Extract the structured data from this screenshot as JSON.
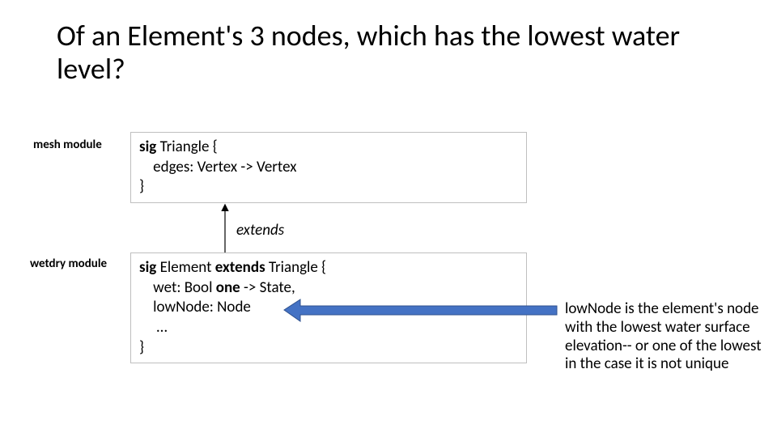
{
  "title": "Of an Element's 3 nodes, which has the lowest water level?",
  "labels": {
    "mesh": "mesh module",
    "wetdry": "wetdry module",
    "extends": "extends"
  },
  "triangle": {
    "l1_kw": "sig ",
    "l1_rest": "Triangle {",
    "l2": "    edges: Vertex -> Vertex",
    "l3": "}"
  },
  "element": {
    "l1_kw": "sig ",
    "l1_mid": "Element ",
    "l1_ext": "extends ",
    "l1_rest": "Triangle {",
    "l2a": "    wet: Bool ",
    "l2b": "one ",
    "l2c": "-> State,",
    "l3": "    lowNode: Node",
    "l4": "     …",
    "l5": "}"
  },
  "annotation": "lowNode is the element's node with the lowest water surface elevation-- or one of the lowest in the case it is not unique"
}
